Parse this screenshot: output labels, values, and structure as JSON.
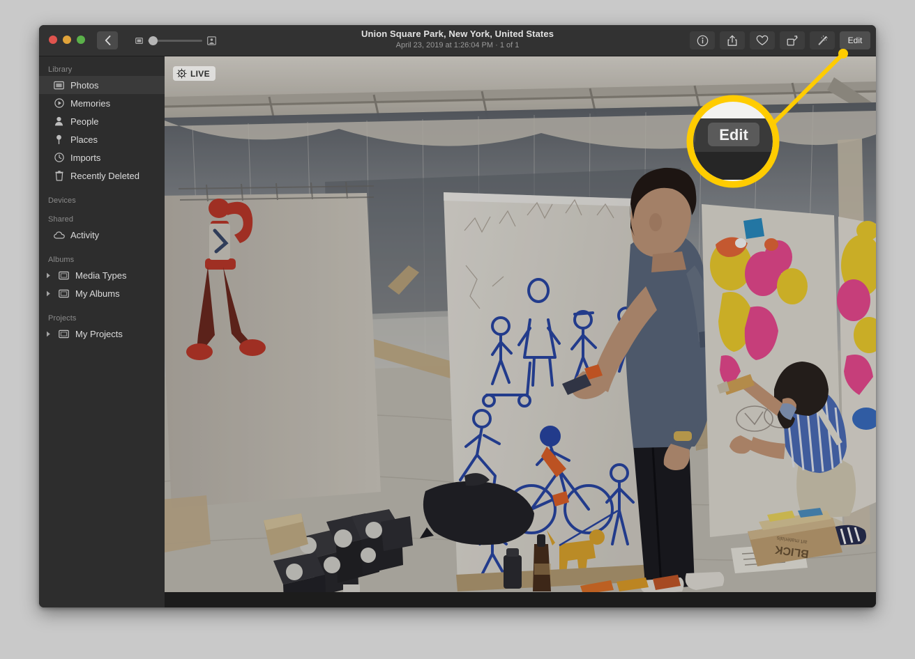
{
  "window": {
    "title": "Union Square Park, New York, United States",
    "subtitle": "April 23, 2019 at 1:26:04 PM  ·  1 of 1",
    "traffic_lights": [
      "close",
      "minimize",
      "zoom"
    ]
  },
  "toolbar": {
    "back_label": "Back",
    "zoom_small_icon": "small-thumbnail-icon",
    "zoom_large_icon": "large-thumbnail-icon",
    "buttons": [
      {
        "name": "info-button",
        "icon": "info-icon",
        "label": ""
      },
      {
        "name": "share-button",
        "icon": "share-icon",
        "label": ""
      },
      {
        "name": "favorite-button",
        "icon": "heart-icon",
        "label": ""
      },
      {
        "name": "rotate-button",
        "icon": "rotate-icon",
        "label": ""
      },
      {
        "name": "enhance-button",
        "icon": "magic-wand-icon",
        "label": ""
      }
    ],
    "edit_label": "Edit"
  },
  "sidebar": {
    "sections": [
      {
        "header": "Library",
        "items": [
          {
            "label": "Photos",
            "icon": "photos-icon",
            "selected": true,
            "expandable": false
          },
          {
            "label": "Memories",
            "icon": "memories-icon",
            "selected": false,
            "expandable": false
          },
          {
            "label": "People",
            "icon": "people-icon",
            "selected": false,
            "expandable": false
          },
          {
            "label": "Places",
            "icon": "places-pin-icon",
            "selected": false,
            "expandable": false
          },
          {
            "label": "Imports",
            "icon": "imports-clock-icon",
            "selected": false,
            "expandable": false
          },
          {
            "label": "Recently Deleted",
            "icon": "trash-icon",
            "selected": false,
            "expandable": false
          }
        ]
      },
      {
        "header": "Devices",
        "items": []
      },
      {
        "header": "Shared",
        "items": [
          {
            "label": "Activity",
            "icon": "cloud-icon",
            "selected": false,
            "expandable": false
          }
        ]
      },
      {
        "header": "Albums",
        "items": [
          {
            "label": "Media Types",
            "icon": "album-icon",
            "selected": false,
            "expandable": true
          },
          {
            "label": "My Albums",
            "icon": "album-icon",
            "selected": false,
            "expandable": true
          }
        ]
      },
      {
        "header": "Projects",
        "items": [
          {
            "label": "My Projects",
            "icon": "album-icon",
            "selected": false,
            "expandable": true
          }
        ]
      }
    ]
  },
  "photo": {
    "live_badge_label": "LIVE",
    "description": "Person in blue-gray t-shirt drawing blue figures on a white canvas inside an event tent; a second person in a striped blue shirt crouches painting colorful pink and yellow artwork on another canvas at right.",
    "visible_text_in_photo": "BLICK art materials"
  },
  "callout": {
    "magnified_label": "Edit",
    "ring_color": "#FFCC00",
    "pointer_color": "#FFCC00",
    "target_button": "edit-button"
  },
  "colors": {
    "desktop_background": "#c9c9c9",
    "window_chrome": "#323232",
    "sidebar_background": "#2d2d2d",
    "selected_row": "#3a3a3a",
    "accent_yellow": "#FFCC00"
  }
}
